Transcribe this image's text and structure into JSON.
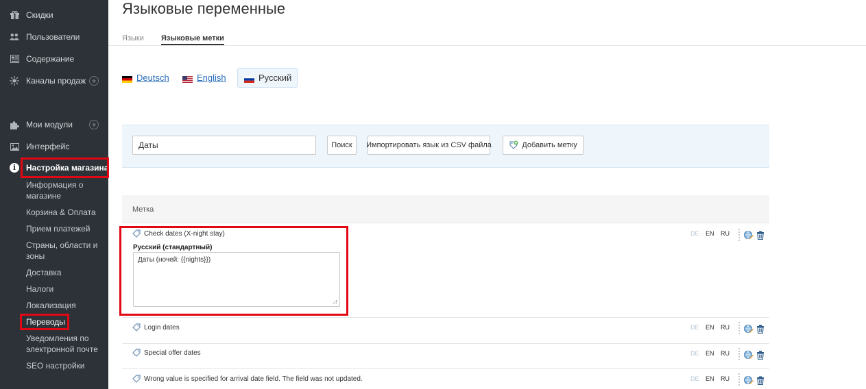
{
  "sidebar": {
    "items": [
      {
        "label": "Скидки",
        "icon": "gift-icon"
      },
      {
        "label": "Пользователи",
        "icon": "users-icon"
      },
      {
        "label": "Содержание",
        "icon": "content-icon"
      },
      {
        "label": "Каналы продаж",
        "icon": "sales-channels-icon"
      },
      {
        "label": "Мои модули",
        "icon": "puzzle-icon"
      },
      {
        "label": "Интерфейс",
        "icon": "image-icon"
      },
      {
        "label": "Настройка магазина",
        "icon": "info-icon"
      }
    ],
    "plus": "+",
    "submenu": [
      "Информация о магазине",
      "Корзина & Оплата",
      "Прием платежей",
      "Страны, области и зоны",
      "Доставка",
      "Налоги",
      "Локализация",
      "Переводы",
      "Уведомления по электронной почте",
      "SEO настройки"
    ]
  },
  "page": {
    "title": "Языковые переменные",
    "tabs": [
      "Языки",
      "Языковые метки"
    ]
  },
  "languages": [
    {
      "label": "Deutsch",
      "flag": "de-flag"
    },
    {
      "label": "English",
      "flag": "us-flag"
    },
    {
      "label": "Русский",
      "flag": "ru-flag"
    }
  ],
  "toolbar": {
    "search_value": "Даты",
    "search_button": "Поиск",
    "import_button": "Импортировать язык из CSV файла",
    "add_button": "Добавить метку"
  },
  "table": {
    "header": "Метка",
    "rows": [
      {
        "label": "Check dates (X-night stay)"
      },
      {
        "label": "Login dates"
      },
      {
        "label": "Special offer dates"
      },
      {
        "label": "Wrong value is specified for arrival date field. The field was not updated."
      }
    ],
    "codes": [
      "DE",
      "EN",
      "RU"
    ]
  },
  "editor": {
    "title": "Русский (стандартный)",
    "value": "Даты (ночей: {{nights}})"
  },
  "colors": {
    "sidebar_bg": "#2d3238",
    "highlight": "#e30613",
    "link": "#2a6ebb"
  }
}
